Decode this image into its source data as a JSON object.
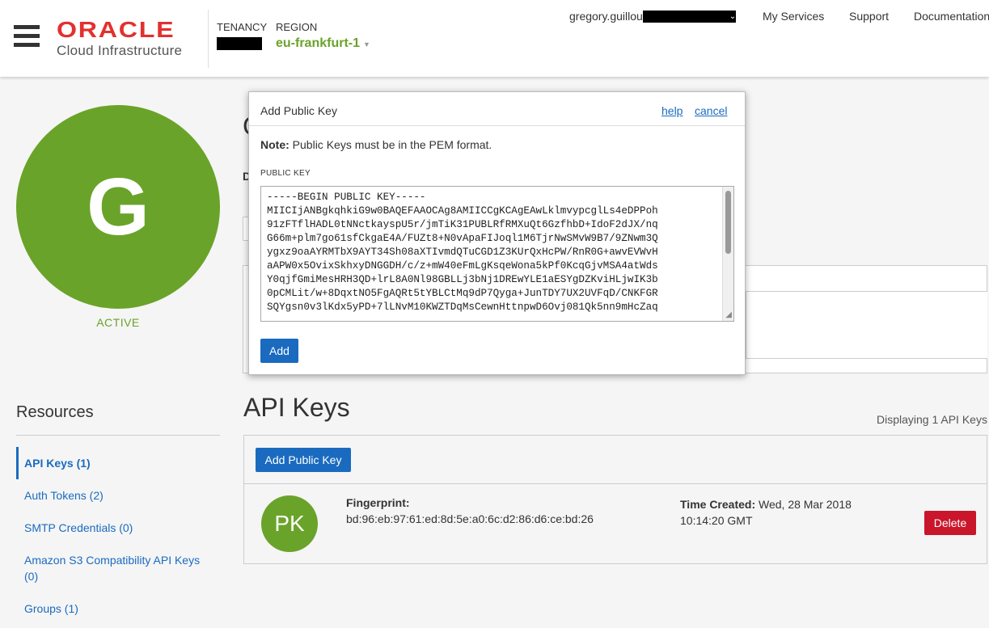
{
  "header": {
    "logo_oracle": "ORACLE",
    "logo_sub": "Cloud Infrastructure",
    "tenancy_label": "TENANCY",
    "region_label": "REGION",
    "region_value": "eu-frankfurt-1",
    "user_name": "gregory.guillou",
    "nav": [
      "My Services",
      "Support",
      "Documentation"
    ]
  },
  "left": {
    "avatar_letter": "G",
    "status": "ACTIVE",
    "resources_title": "Resources",
    "resources": [
      {
        "label": "API Keys (1)"
      },
      {
        "label": "Auth Tokens (2)"
      },
      {
        "label": "SMTP Credentials (0)"
      },
      {
        "label": "Amazon S3 Compatibility API Keys (0)"
      },
      {
        "label": "Groups (1)"
      }
    ]
  },
  "main": {
    "title_fragment": "G",
    "d_fragment": "D",
    "api_keys_title": "API Keys",
    "displaying": "Displaying 1 API Keys",
    "add_public_key_button": "Add Public Key",
    "key_row": {
      "avatar": "PK",
      "fingerprint_label": "Fingerprint:",
      "fingerprint_value": "bd:96:eb:97:61:ed:8d:5e:a0:6c:d2:86:d6:ce:bd:26",
      "time_created_label": "Time Created:",
      "time_created_value": "Wed, 28 Mar 2018 10:14:20 GMT",
      "delete_button": "Delete"
    }
  },
  "modal": {
    "title": "Add Public Key",
    "help_link": "help",
    "cancel_link": "cancel",
    "note_label": "Note:",
    "note_text": "Public Keys must be in the PEM format.",
    "field_label": "PUBLIC KEY",
    "public_key_value": "-----BEGIN PUBLIC KEY-----\nMIICIjANBgkqhkiG9w0BAQEFAAOCAg8AMIICCgKCAgEAwLklmvypcglLs4eDPPoh\n91zFTflHADL0tNNctkayspU5r/jmTiK31PUBLRfRMXuQt6GzfhbD+IdoF2dJX/nq\nG66m+plm7go61sfCkgaE4A/FUZt8+N0vApaFIJoql1M6TjrNwSMvW9B7/9ZNwm3Q\nygxz9oaAYRMTbX9AYT34Sh08aXTIvmdQTuCGD1Z3KUrQxHcPW/RnR0G+awvEVWvH\naAPW0x5OvixSkhxyDNGGDH/c/z+mW40eFmLgKsqeWona5kPf0KcqGjvMSA4atWds\nY0qjfGmiMesHRH3QD+lrL8A0Nl98GBLLj3bNj1DREwYLE1aESYgDZKviHLjwIK3b\n0pCMLit/w+8DqxtNO5FgAQRt5tYBLCtMq9dP7Qyga+JunTDY7UX2UVFqD/CNKFGR\nSQYgsn0v3lKdx5yPD+7lLNvM10KWZTDqMsCewnHttnpwD6Ovj081Qk5nn9mHcZaq",
    "add_button": "Add"
  }
}
